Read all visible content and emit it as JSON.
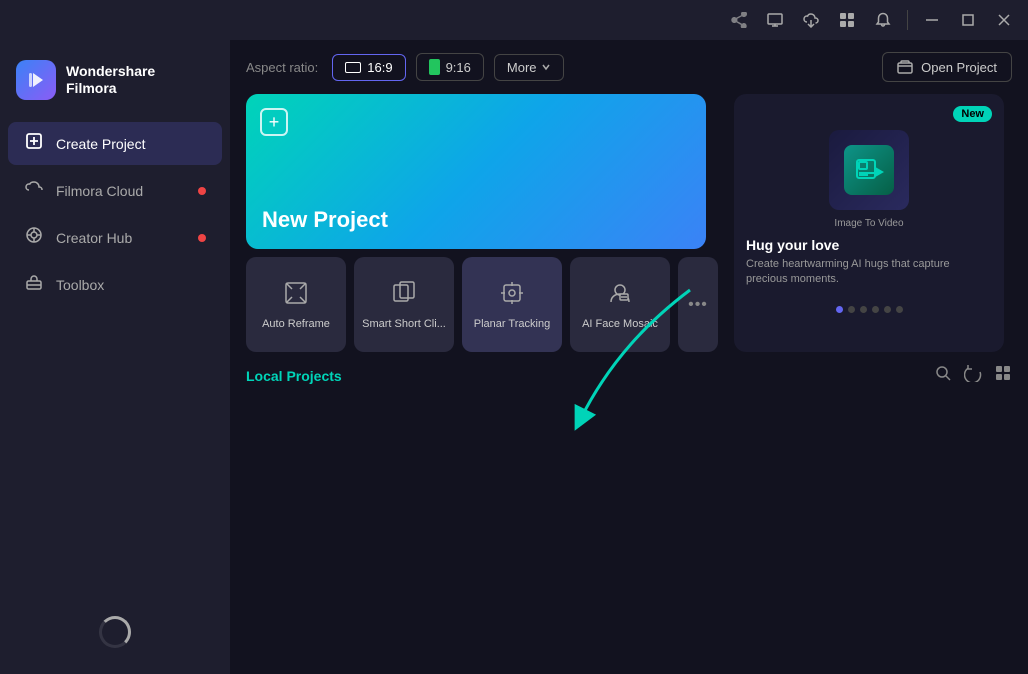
{
  "titlebar": {
    "icons": [
      "share-icon",
      "monitor-icon",
      "cloud-icon",
      "grid-icon",
      "bell-icon",
      "minimize-icon",
      "maximize-icon",
      "close-icon"
    ]
  },
  "sidebar": {
    "logo": {
      "title": "Wondershare",
      "subtitle": "Filmora"
    },
    "items": [
      {
        "id": "create-project",
        "label": "Create Project",
        "active": true,
        "dot": false
      },
      {
        "id": "filmora-cloud",
        "label": "Filmora Cloud",
        "active": false,
        "dot": true
      },
      {
        "id": "creator-hub",
        "label": "Creator Hub",
        "active": false,
        "dot": true
      },
      {
        "id": "toolbox",
        "label": "Toolbox",
        "active": false,
        "dot": false
      }
    ]
  },
  "topbar": {
    "aspect_ratio_label": "Aspect ratio:",
    "aspect_16_9": "16:9",
    "aspect_9_16": "9:16",
    "more_label": "More",
    "open_project_label": "Open Project"
  },
  "new_project": {
    "title": "New Project",
    "plus_symbol": "+"
  },
  "feature_cards": [
    {
      "id": "auto-reframe",
      "label": "Auto Reframe",
      "icon": "↗"
    },
    {
      "id": "smart-short-clip",
      "label": "Smart Short Cli...",
      "icon": "⧉"
    },
    {
      "id": "planar-tracking",
      "label": "Planar Tracking",
      "icon": "⊕"
    },
    {
      "id": "ai-face-mosaic",
      "label": "AI Face Mosaic",
      "icon": "🎭"
    }
  ],
  "more_card_label": "•••",
  "right_panel": {
    "badge": "New",
    "img_alt": "Image To Video icon",
    "img_label": "Image To Video",
    "title": "Hug your love",
    "description": "Create heartwarming AI hugs that capture precious moments.",
    "dots": [
      true,
      false,
      false,
      false,
      false,
      false
    ]
  },
  "local_projects": {
    "title": "Local Projects",
    "actions": [
      "search-icon",
      "refresh-icon",
      "grid-view-icon"
    ]
  }
}
